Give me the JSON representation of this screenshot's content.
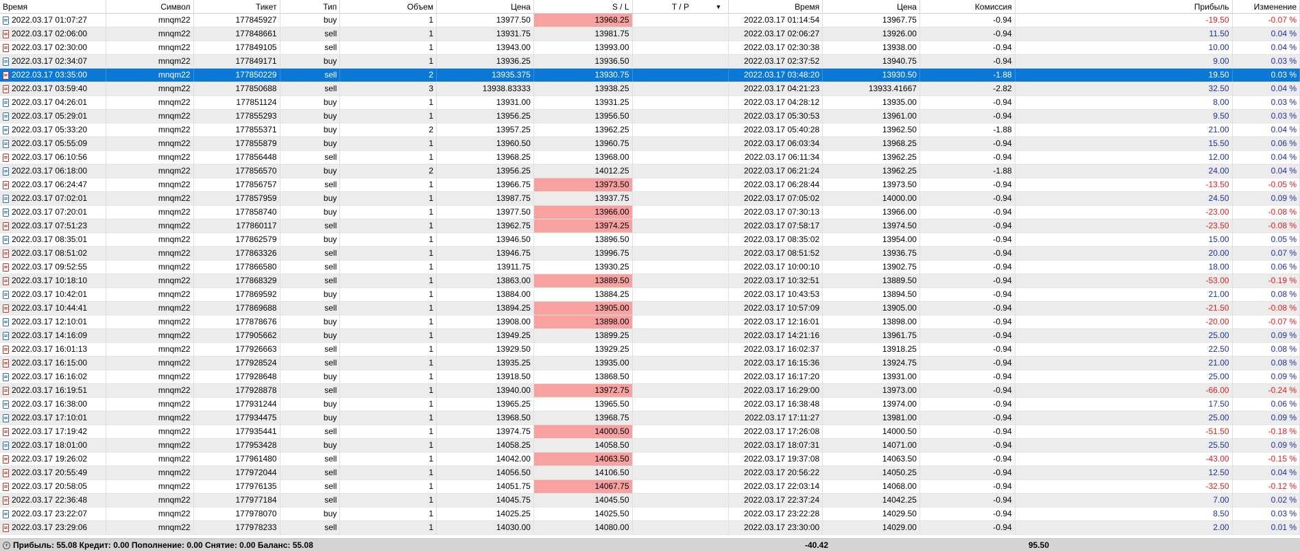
{
  "columns": [
    "Время",
    "Символ",
    "Тикет",
    "Тип",
    "Объем",
    "Цена",
    "S / L",
    "T / P",
    "Время",
    "Цена",
    "Комиссия",
    "Прибыль",
    "Изменение"
  ],
  "sort_icon": "sort-down-arrow-icon",
  "rows": [
    {
      "open_time": "2022.03.17 01:07:27",
      "symbol": "mnqm22",
      "ticket": "177845927",
      "type": "buy",
      "volume": "1",
      "price": "13977.50",
      "sl": "13968.25",
      "tp": "",
      "close_time": "2022.03.17 01:14:54",
      "close_price": "13967.75",
      "commission": "-0.94",
      "profit": "-19.50",
      "change": "-0.07 %",
      "sl_hit": true
    },
    {
      "open_time": "2022.03.17 02:06:00",
      "symbol": "mnqm22",
      "ticket": "177848661",
      "type": "sell",
      "volume": "1",
      "price": "13931.75",
      "sl": "13981.75",
      "tp": "",
      "close_time": "2022.03.17 02:06:27",
      "close_price": "13926.00",
      "commission": "-0.94",
      "profit": "11.50",
      "change": "0.04 %",
      "sl_hit": false
    },
    {
      "open_time": "2022.03.17 02:30:00",
      "symbol": "mnqm22",
      "ticket": "177849105",
      "type": "sell",
      "volume": "1",
      "price": "13943.00",
      "sl": "13993.00",
      "tp": "",
      "close_time": "2022.03.17 02:30:38",
      "close_price": "13938.00",
      "commission": "-0.94",
      "profit": "10.00",
      "change": "0.04 %",
      "sl_hit": false
    },
    {
      "open_time": "2022.03.17 02:34:07",
      "symbol": "mnqm22",
      "ticket": "177849171",
      "type": "buy",
      "volume": "1",
      "price": "13936.25",
      "sl": "13936.50",
      "tp": "",
      "close_time": "2022.03.17 02:37:52",
      "close_price": "13940.75",
      "commission": "-0.94",
      "profit": "9.00",
      "change": "0.03 %",
      "sl_hit": false
    },
    {
      "open_time": "2022.03.17 03:35:00",
      "symbol": "mnqm22",
      "ticket": "177850229",
      "type": "sell",
      "volume": "2",
      "price": "13935.375",
      "sl": "13930.75",
      "tp": "",
      "close_time": "2022.03.17 03:48:20",
      "close_price": "13930.50",
      "commission": "-1.88",
      "profit": "19.50",
      "change": "0.03 %",
      "sl_hit": false,
      "selected": true
    },
    {
      "open_time": "2022.03.17 03:59:40",
      "symbol": "mnqm22",
      "ticket": "177850688",
      "type": "sell",
      "volume": "3",
      "price": "13938.83333",
      "sl": "13938.25",
      "tp": "",
      "close_time": "2022.03.17 04:21:23",
      "close_price": "13933.41667",
      "commission": "-2.82",
      "profit": "32.50",
      "change": "0.04 %",
      "sl_hit": false
    },
    {
      "open_time": "2022.03.17 04:26:01",
      "symbol": "mnqm22",
      "ticket": "177851124",
      "type": "buy",
      "volume": "1",
      "price": "13931.00",
      "sl": "13931.25",
      "tp": "",
      "close_time": "2022.03.17 04:28:12",
      "close_price": "13935.00",
      "commission": "-0.94",
      "profit": "8.00",
      "change": "0.03 %",
      "sl_hit": false
    },
    {
      "open_time": "2022.03.17 05:29:01",
      "symbol": "mnqm22",
      "ticket": "177855293",
      "type": "buy",
      "volume": "1",
      "price": "13956.25",
      "sl": "13956.50",
      "tp": "",
      "close_time": "2022.03.17 05:30:53",
      "close_price": "13961.00",
      "commission": "-0.94",
      "profit": "9.50",
      "change": "0.03 %",
      "sl_hit": false
    },
    {
      "open_time": "2022.03.17 05:33:20",
      "symbol": "mnqm22",
      "ticket": "177855371",
      "type": "buy",
      "volume": "2",
      "price": "13957.25",
      "sl": "13962.25",
      "tp": "",
      "close_time": "2022.03.17 05:40:28",
      "close_price": "13962.50",
      "commission": "-1.88",
      "profit": "21.00",
      "change": "0.04 %",
      "sl_hit": false
    },
    {
      "open_time": "2022.03.17 05:55:09",
      "symbol": "mnqm22",
      "ticket": "177855879",
      "type": "buy",
      "volume": "1",
      "price": "13960.50",
      "sl": "13960.75",
      "tp": "",
      "close_time": "2022.03.17 06:03:34",
      "close_price": "13968.25",
      "commission": "-0.94",
      "profit": "15.50",
      "change": "0.06 %",
      "sl_hit": false
    },
    {
      "open_time": "2022.03.17 06:10:56",
      "symbol": "mnqm22",
      "ticket": "177856448",
      "type": "sell",
      "volume": "1",
      "price": "13968.25",
      "sl": "13968.00",
      "tp": "",
      "close_time": "2022.03.17 06:11:34",
      "close_price": "13962.25",
      "commission": "-0.94",
      "profit": "12.00",
      "change": "0.04 %",
      "sl_hit": false
    },
    {
      "open_time": "2022.03.17 06:18:00",
      "symbol": "mnqm22",
      "ticket": "177856570",
      "type": "buy",
      "volume": "2",
      "price": "13956.25",
      "sl": "14012.25",
      "tp": "",
      "close_time": "2022.03.17 06:21:24",
      "close_price": "13962.25",
      "commission": "-1.88",
      "profit": "24.00",
      "change": "0.04 %",
      "sl_hit": false
    },
    {
      "open_time": "2022.03.17 06:24:47",
      "symbol": "mnqm22",
      "ticket": "177856757",
      "type": "sell",
      "volume": "1",
      "price": "13966.75",
      "sl": "13973.50",
      "tp": "",
      "close_time": "2022.03.17 06:28:44",
      "close_price": "13973.50",
      "commission": "-0.94",
      "profit": "-13.50",
      "change": "-0.05 %",
      "sl_hit": true
    },
    {
      "open_time": "2022.03.17 07:02:01",
      "symbol": "mnqm22",
      "ticket": "177857959",
      "type": "buy",
      "volume": "1",
      "price": "13987.75",
      "sl": "13937.75",
      "tp": "",
      "close_time": "2022.03.17 07:05:02",
      "close_price": "14000.00",
      "commission": "-0.94",
      "profit": "24.50",
      "change": "0.09 %",
      "sl_hit": false
    },
    {
      "open_time": "2022.03.17 07:20:01",
      "symbol": "mnqm22",
      "ticket": "177858740",
      "type": "buy",
      "volume": "1",
      "price": "13977.50",
      "sl": "13966.00",
      "tp": "",
      "close_time": "2022.03.17 07:30:13",
      "close_price": "13966.00",
      "commission": "-0.94",
      "profit": "-23.00",
      "change": "-0.08 %",
      "sl_hit": true
    },
    {
      "open_time": "2022.03.17 07:51:23",
      "symbol": "mnqm22",
      "ticket": "177860117",
      "type": "sell",
      "volume": "1",
      "price": "13962.75",
      "sl": "13974.25",
      "tp": "",
      "close_time": "2022.03.17 07:58:17",
      "close_price": "13974.50",
      "commission": "-0.94",
      "profit": "-23.50",
      "change": "-0.08 %",
      "sl_hit": true
    },
    {
      "open_time": "2022.03.17 08:35:01",
      "symbol": "mnqm22",
      "ticket": "177862579",
      "type": "buy",
      "volume": "1",
      "price": "13946.50",
      "sl": "13896.50",
      "tp": "",
      "close_time": "2022.03.17 08:35:02",
      "close_price": "13954.00",
      "commission": "-0.94",
      "profit": "15.00",
      "change": "0.05 %",
      "sl_hit": false
    },
    {
      "open_time": "2022.03.17 08:51:02",
      "symbol": "mnqm22",
      "ticket": "177863326",
      "type": "sell",
      "volume": "1",
      "price": "13946.75",
      "sl": "13996.75",
      "tp": "",
      "close_time": "2022.03.17 08:51:52",
      "close_price": "13936.75",
      "commission": "-0.94",
      "profit": "20.00",
      "change": "0.07 %",
      "sl_hit": false
    },
    {
      "open_time": "2022.03.17 09:52:55",
      "symbol": "mnqm22",
      "ticket": "177866580",
      "type": "sell",
      "volume": "1",
      "price": "13911.75",
      "sl": "13930.25",
      "tp": "",
      "close_time": "2022.03.17 10:00:10",
      "close_price": "13902.75",
      "commission": "-0.94",
      "profit": "18.00",
      "change": "0.06 %",
      "sl_hit": false
    },
    {
      "open_time": "2022.03.17 10:18:10",
      "symbol": "mnqm22",
      "ticket": "177868329",
      "type": "sell",
      "volume": "1",
      "price": "13863.00",
      "sl": "13889.50",
      "tp": "",
      "close_time": "2022.03.17 10:32:51",
      "close_price": "13889.50",
      "commission": "-0.94",
      "profit": "-53.00",
      "change": "-0.19 %",
      "sl_hit": true
    },
    {
      "open_time": "2022.03.17 10:42:01",
      "symbol": "mnqm22",
      "ticket": "177869592",
      "type": "buy",
      "volume": "1",
      "price": "13884.00",
      "sl": "13884.25",
      "tp": "",
      "close_time": "2022.03.17 10:43:53",
      "close_price": "13894.50",
      "commission": "-0.94",
      "profit": "21.00",
      "change": "0.08 %",
      "sl_hit": false
    },
    {
      "open_time": "2022.03.17 10:44:41",
      "symbol": "mnqm22",
      "ticket": "177869688",
      "type": "sell",
      "volume": "1",
      "price": "13894.25",
      "sl": "13905.00",
      "tp": "",
      "close_time": "2022.03.17 10:57:09",
      "close_price": "13905.00",
      "commission": "-0.94",
      "profit": "-21.50",
      "change": "-0.08 %",
      "sl_hit": true
    },
    {
      "open_time": "2022.03.17 12:10:01",
      "symbol": "mnqm22",
      "ticket": "177878676",
      "type": "buy",
      "volume": "1",
      "price": "13908.00",
      "sl": "13898.00",
      "tp": "",
      "close_time": "2022.03.17 12:16:01",
      "close_price": "13898.00",
      "commission": "-0.94",
      "profit": "-20.00",
      "change": "-0.07 %",
      "sl_hit": true
    },
    {
      "open_time": "2022.03.17 14:16:09",
      "symbol": "mnqm22",
      "ticket": "177905662",
      "type": "buy",
      "volume": "1",
      "price": "13949.25",
      "sl": "13899.25",
      "tp": "",
      "close_time": "2022.03.17 14:21:16",
      "close_price": "13961.75",
      "commission": "-0.94",
      "profit": "25.00",
      "change": "0.09 %",
      "sl_hit": false
    },
    {
      "open_time": "2022.03.17 16:01:13",
      "symbol": "mnqm22",
      "ticket": "177926663",
      "type": "sell",
      "volume": "1",
      "price": "13929.50",
      "sl": "13929.25",
      "tp": "",
      "close_time": "2022.03.17 16:02:37",
      "close_price": "13918.25",
      "commission": "-0.94",
      "profit": "22.50",
      "change": "0.08 %",
      "sl_hit": false
    },
    {
      "open_time": "2022.03.17 16:15:00",
      "symbol": "mnqm22",
      "ticket": "177928524",
      "type": "sell",
      "volume": "1",
      "price": "13935.25",
      "sl": "13935.00",
      "tp": "",
      "close_time": "2022.03.17 16:15:36",
      "close_price": "13924.75",
      "commission": "-0.94",
      "profit": "21.00",
      "change": "0.08 %",
      "sl_hit": false
    },
    {
      "open_time": "2022.03.17 16:16:02",
      "symbol": "mnqm22",
      "ticket": "177928648",
      "type": "buy",
      "volume": "1",
      "price": "13918.50",
      "sl": "13868.50",
      "tp": "",
      "close_time": "2022.03.17 16:17:20",
      "close_price": "13931.00",
      "commission": "-0.94",
      "profit": "25.00",
      "change": "0.09 %",
      "sl_hit": false
    },
    {
      "open_time": "2022.03.17 16:19:51",
      "symbol": "mnqm22",
      "ticket": "177928878",
      "type": "sell",
      "volume": "1",
      "price": "13940.00",
      "sl": "13972.75",
      "tp": "",
      "close_time": "2022.03.17 16:29:00",
      "close_price": "13973.00",
      "commission": "-0.94",
      "profit": "-66.00",
      "change": "-0.24 %",
      "sl_hit": true
    },
    {
      "open_time": "2022.03.17 16:38:00",
      "symbol": "mnqm22",
      "ticket": "177931244",
      "type": "buy",
      "volume": "1",
      "price": "13965.25",
      "sl": "13965.50",
      "tp": "",
      "close_time": "2022.03.17 16:38:48",
      "close_price": "13974.00",
      "commission": "-0.94",
      "profit": "17.50",
      "change": "0.06 %",
      "sl_hit": false
    },
    {
      "open_time": "2022.03.17 17:10:01",
      "symbol": "mnqm22",
      "ticket": "177934475",
      "type": "buy",
      "volume": "1",
      "price": "13968.50",
      "sl": "13968.75",
      "tp": "",
      "close_time": "2022.03.17 17:11:27",
      "close_price": "13981.00",
      "commission": "-0.94",
      "profit": "25.00",
      "change": "0.09 %",
      "sl_hit": false
    },
    {
      "open_time": "2022.03.17 17:19:42",
      "symbol": "mnqm22",
      "ticket": "177935441",
      "type": "sell",
      "volume": "1",
      "price": "13974.75",
      "sl": "14000.50",
      "tp": "",
      "close_time": "2022.03.17 17:26:08",
      "close_price": "14000.50",
      "commission": "-0.94",
      "profit": "-51.50",
      "change": "-0.18 %",
      "sl_hit": true
    },
    {
      "open_time": "2022.03.17 18:01:00",
      "symbol": "mnqm22",
      "ticket": "177953428",
      "type": "buy",
      "volume": "1",
      "price": "14058.25",
      "sl": "14058.50",
      "tp": "",
      "close_time": "2022.03.17 18:07:31",
      "close_price": "14071.00",
      "commission": "-0.94",
      "profit": "25.50",
      "change": "0.09 %",
      "sl_hit": false
    },
    {
      "open_time": "2022.03.17 19:26:02",
      "symbol": "mnqm22",
      "ticket": "177961480",
      "type": "sell",
      "volume": "1",
      "price": "14042.00",
      "sl": "14063.50",
      "tp": "",
      "close_time": "2022.03.17 19:37:08",
      "close_price": "14063.50",
      "commission": "-0.94",
      "profit": "-43.00",
      "change": "-0.15 %",
      "sl_hit": true
    },
    {
      "open_time": "2022.03.17 20:55:49",
      "symbol": "mnqm22",
      "ticket": "177972044",
      "type": "sell",
      "volume": "1",
      "price": "14056.50",
      "sl": "14106.50",
      "tp": "",
      "close_time": "2022.03.17 20:56:22",
      "close_price": "14050.25",
      "commission": "-0.94",
      "profit": "12.50",
      "change": "0.04 %",
      "sl_hit": false
    },
    {
      "open_time": "2022.03.17 20:58:05",
      "symbol": "mnqm22",
      "ticket": "177976135",
      "type": "sell",
      "volume": "1",
      "price": "14051.75",
      "sl": "14067.75",
      "tp": "",
      "close_time": "2022.03.17 22:03:14",
      "close_price": "14068.00",
      "commission": "-0.94",
      "profit": "-32.50",
      "change": "-0.12 %",
      "sl_hit": true
    },
    {
      "open_time": "2022.03.17 22:36:48",
      "symbol": "mnqm22",
      "ticket": "177977184",
      "type": "sell",
      "volume": "1",
      "price": "14045.75",
      "sl": "14045.50",
      "tp": "",
      "close_time": "2022.03.17 22:37:24",
      "close_price": "14042.25",
      "commission": "-0.94",
      "profit": "7.00",
      "change": "0.02 %",
      "sl_hit": false
    },
    {
      "open_time": "2022.03.17 23:22:07",
      "symbol": "mnqm22",
      "ticket": "177978070",
      "type": "buy",
      "volume": "1",
      "price": "14025.25",
      "sl": "14025.50",
      "tp": "",
      "close_time": "2022.03.17 23:22:28",
      "close_price": "14029.50",
      "commission": "-0.94",
      "profit": "8.50",
      "change": "0.03 %",
      "sl_hit": false
    },
    {
      "open_time": "2022.03.17 23:29:06",
      "symbol": "mnqm22",
      "ticket": "177978233",
      "type": "sell",
      "volume": "1",
      "price": "14030.00",
      "sl": "14080.00",
      "tp": "",
      "close_time": "2022.03.17 23:30:00",
      "close_price": "14029.00",
      "commission": "-0.94",
      "profit": "2.00",
      "change": "0.01 %",
      "sl_hit": false
    }
  ],
  "footer": {
    "summary": "Прибыль: 55.08  Кредит: 0.00  Пополнение: 0.00  Снятие: 0.00  Баланс: 55.08",
    "commission_total": "-40.42",
    "profit_total": "95.50"
  },
  "colors": {
    "selected_row": "#0a78d7",
    "sl_hit_bg": "#f8a1a1",
    "negative": "#e31b1b",
    "positive": "#1b2fa5",
    "footer_bg": "#d4d4d4"
  }
}
